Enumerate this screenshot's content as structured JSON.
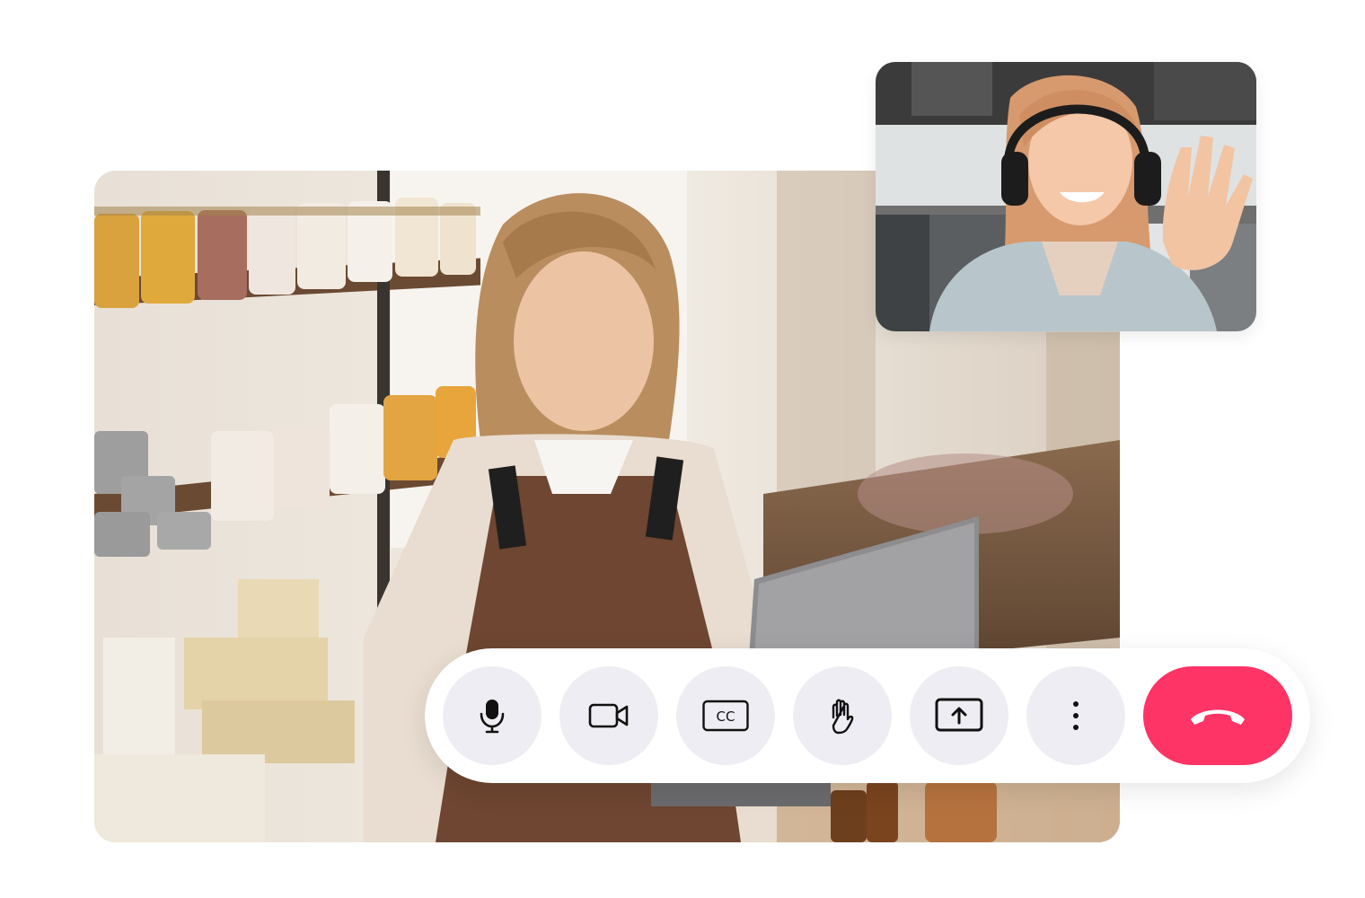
{
  "call": {
    "main_feed_icon": "participant-video",
    "pip_feed_icon": "self-video"
  },
  "controls": {
    "mic": {
      "icon": "microphone-icon"
    },
    "camera": {
      "icon": "video-camera-icon"
    },
    "captions": {
      "icon": "closed-captions-icon",
      "label": "CC"
    },
    "raise_hand": {
      "icon": "hand-icon"
    },
    "share_screen": {
      "icon": "share-screen-icon"
    },
    "more": {
      "icon": "more-vertical-icon"
    },
    "end_call": {
      "icon": "hang-up-icon"
    }
  },
  "colors": {
    "end_call": "#fe3466",
    "control_bg": "#eeedf4",
    "icon": "#111111"
  }
}
